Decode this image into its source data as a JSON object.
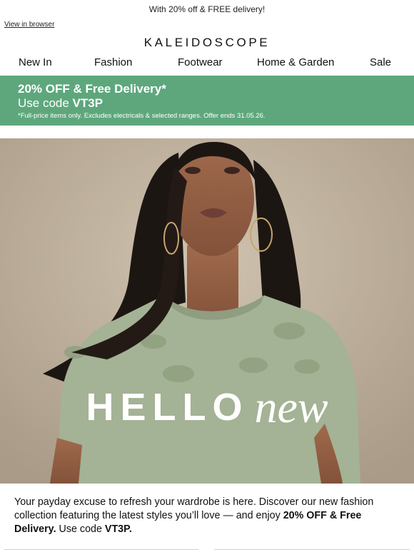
{
  "preheader": "With 20% off & FREE delivery!",
  "view_in_browser": "View in browser",
  "logo": "KALEIDOSCOPE",
  "nav": [
    "New In",
    "Fashion",
    "Footwear",
    "Home & Garden",
    "Sale"
  ],
  "promo": {
    "headline": "20% OFF & Free Delivery*",
    "code_prefix": "Use code ",
    "code": "VT3P",
    "fine_print": "*Full-price items only. Excludes electricals & selected ranges. Offer ends 31.05.26.",
    "background": "#5ea77c"
  },
  "hero": {
    "word1": "HELLO",
    "word2": "new"
  },
  "body": {
    "text1": "Your payday excuse to refresh your wardrobe is here. Discover our new fashion collection featuring the latest styles you’ll love — and enjoy ",
    "bold1": "20% OFF & Free Delivery.",
    "text2": " Use code ",
    "bold2": "VT3P."
  }
}
